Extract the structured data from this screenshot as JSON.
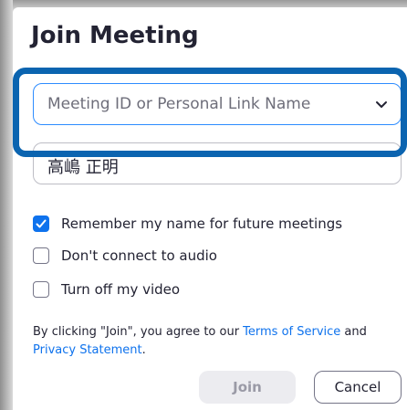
{
  "dialog": {
    "title": "Join Meeting"
  },
  "meeting_id": {
    "placeholder": "Meeting ID or Personal Link Name",
    "dropdown_icon": "chevron-down-icon"
  },
  "name_field": {
    "value": "高嶋 正明"
  },
  "options": [
    {
      "label": "Remember my name for future meetings",
      "checked": true
    },
    {
      "label": "Don't connect to audio",
      "checked": false
    },
    {
      "label": "Turn off my video",
      "checked": false
    }
  ],
  "terms": {
    "prefix": "By clicking \"Join\", you agree to our ",
    "tos_link": "Terms of Service",
    "middle": " and ",
    "privacy_link": "Privacy Statement",
    "suffix": "."
  },
  "buttons": {
    "join": "Join",
    "cancel": "Cancel"
  },
  "colors": {
    "accent": "#0e72ed",
    "focus_border": "#2d8cff",
    "highlight": "#0b64b0"
  }
}
